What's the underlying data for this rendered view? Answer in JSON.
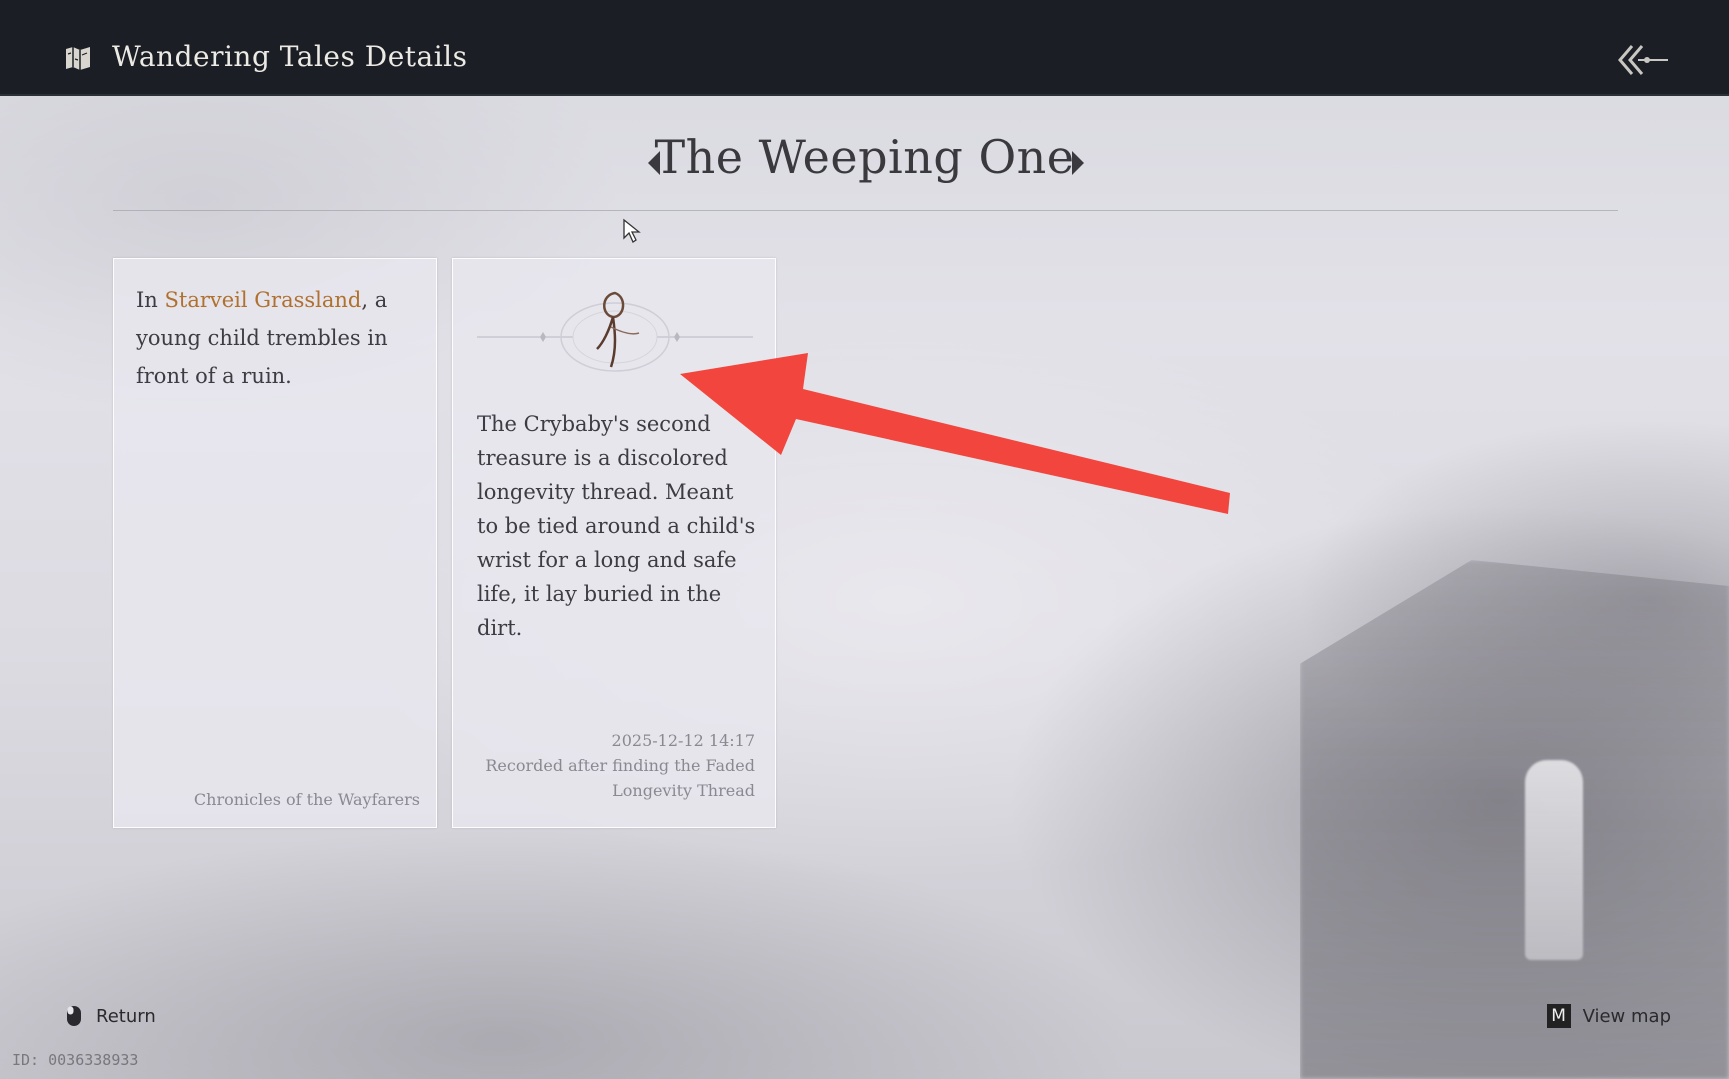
{
  "header": {
    "title": "Wandering Tales Details",
    "icon": "map-icon"
  },
  "tale": {
    "title": "The Weeping One",
    "prev_icon": "caret-left-icon",
    "next_icon": "caret-right-icon"
  },
  "cards": [
    {
      "text_before": "In ",
      "place": "Starveil Grassland",
      "text_after": ", a young child trembles in front of a ruin.",
      "source": "Chronicles of the Wayfarers"
    },
    {
      "item_icon": "longevity-thread-icon",
      "text": "The Crybaby's second treasure is a discolored longevity thread. Meant to be tied around a child's wrist for a long and safe life, it lay buried in the dirt.",
      "timestamp": "2025-12-12 14:17",
      "recorded_note": "Recorded after finding the Faded Longevity Thread"
    }
  ],
  "footer": {
    "return_label": "Return",
    "view_map_key": "M",
    "view_map_label": "View map"
  },
  "id_text": "ID: 0036338933",
  "colors": {
    "topbar": "#1b1e24",
    "place_highlight": "#b0702e",
    "annotation_arrow": "#f2453d"
  }
}
